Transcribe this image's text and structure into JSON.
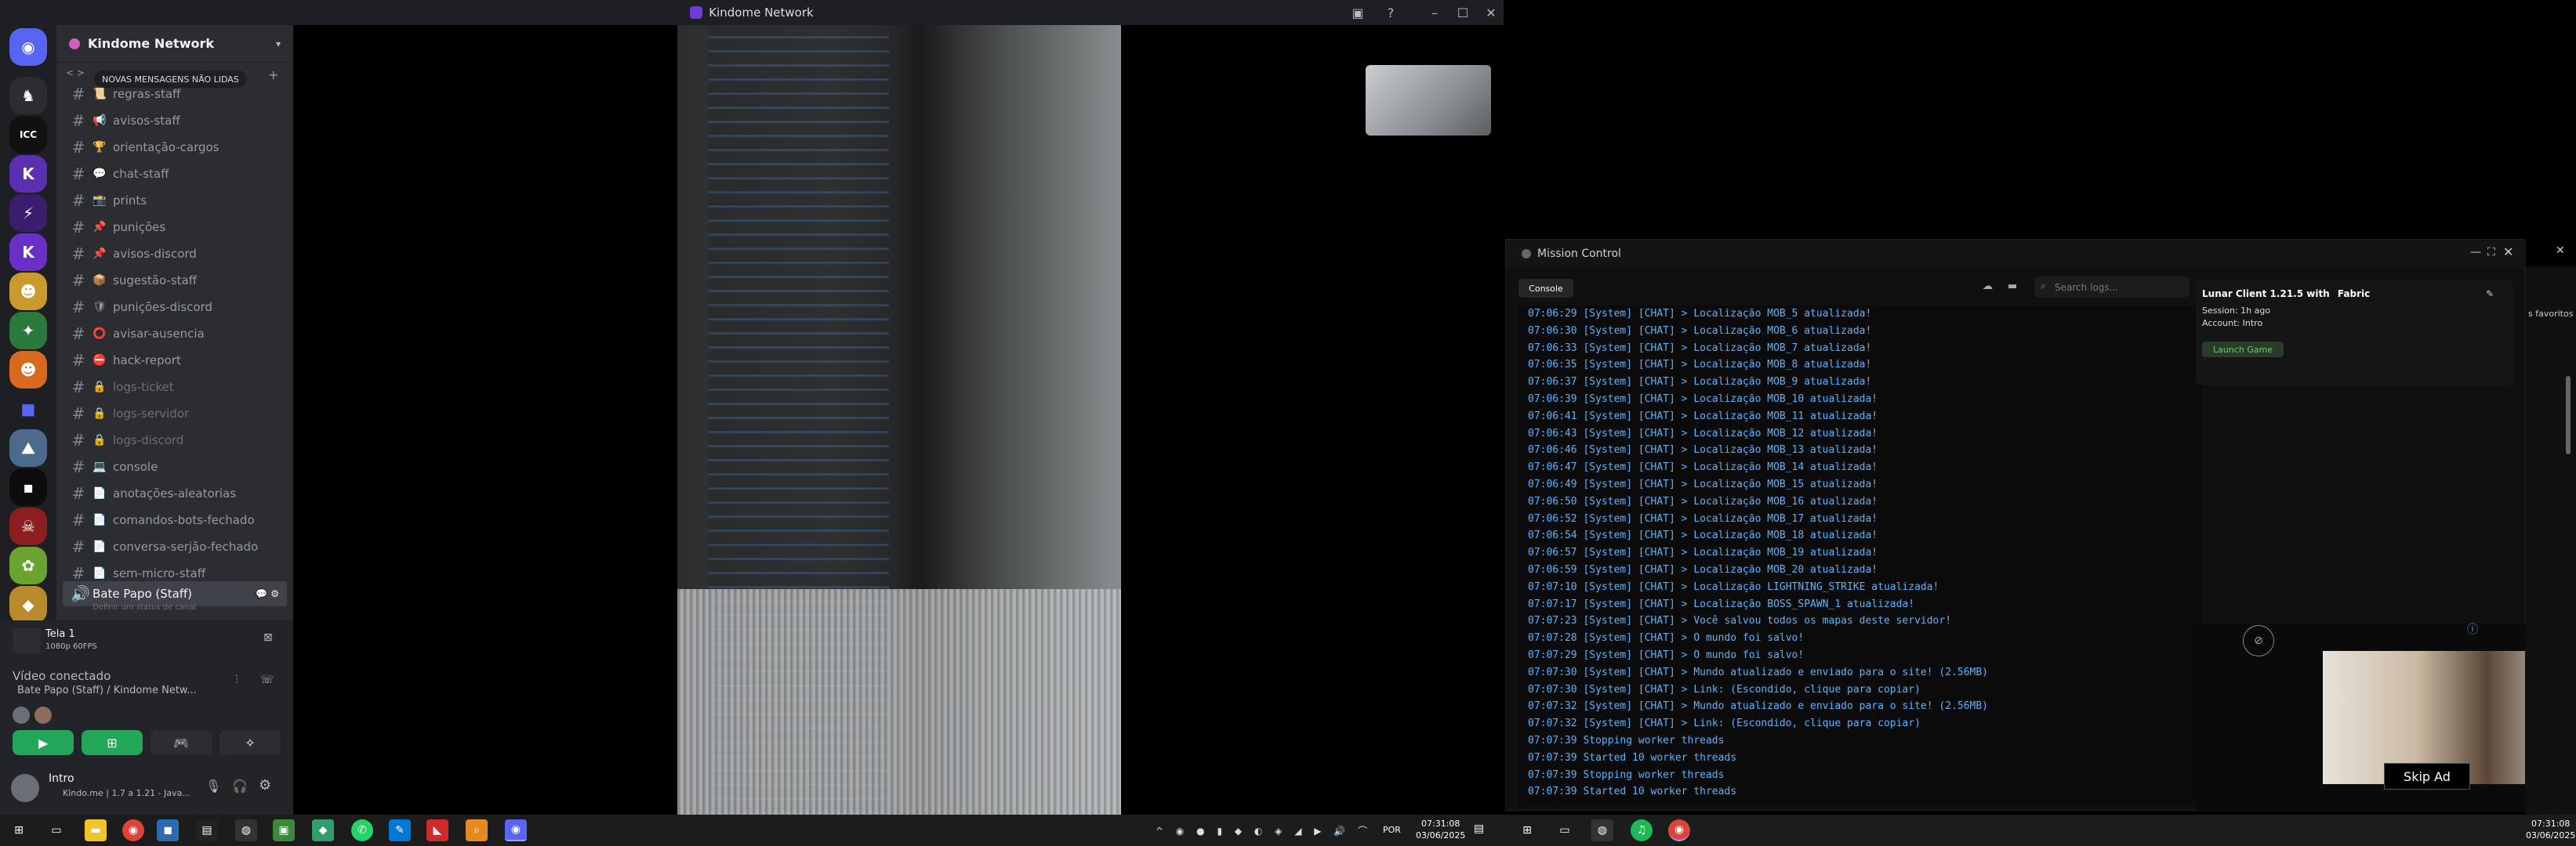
{
  "discord": {
    "window_title": "Kindome Network",
    "server_name": "Kindome Network",
    "new_messages_pill": "NOVAS MENSAGENS NÃO LIDAS",
    "channels": [
      {
        "name": "regras-staff",
        "emoji": "📜",
        "locked": false
      },
      {
        "name": "avisos-staff",
        "emoji": "📢",
        "locked": false
      },
      {
        "name": "orientação-cargos",
        "emoji": "🏆",
        "locked": false
      },
      {
        "name": "chat-staff",
        "emoji": "💬",
        "locked": false
      },
      {
        "name": "prints",
        "emoji": "📸",
        "locked": false
      },
      {
        "name": "punições",
        "emoji": "📌",
        "locked": false
      },
      {
        "name": "avisos-discord",
        "emoji": "📌",
        "locked": false
      },
      {
        "name": "sugestão-staff",
        "emoji": "📦",
        "locked": false
      },
      {
        "name": "punições-discord",
        "emoji": "🛡",
        "locked": false
      },
      {
        "name": "avisar-ausencia",
        "emoji": "⭕",
        "locked": false
      },
      {
        "name": "hack-report",
        "emoji": "⛔",
        "locked": false
      },
      {
        "name": "logs-ticket",
        "emoji": "🔒",
        "locked": true
      },
      {
        "name": "logs-servidor",
        "emoji": "🔒",
        "locked": true
      },
      {
        "name": "logs-discord",
        "emoji": "🔒",
        "locked": true
      },
      {
        "name": "console",
        "emoji": "💻",
        "locked": false
      },
      {
        "name": "anotações-aleatorias",
        "emoji": "📄",
        "locked": false
      },
      {
        "name": "comandos-bots-fechado",
        "emoji": "📄",
        "locked": false
      },
      {
        "name": "conversa-serjão-fechado",
        "emoji": "📄",
        "locked": false
      },
      {
        "name": "sem-micro-staff",
        "emoji": "📄",
        "locked": false
      }
    ],
    "voice_channel": "Bate Papo (Staff)",
    "voice_status_hint": "Definir um status de canal",
    "stream": {
      "title": "Tela 1",
      "quality": "1080p 60FPS"
    },
    "voice_connected": "Vídeo conectado",
    "voice_location": "Bate Papo (Staff) / Kindome Netw...",
    "user": {
      "name": "Intro",
      "status": "Kindo.me | 1.7 a 1.21 - Java..."
    }
  },
  "mission_control": {
    "title": "Mission Control",
    "console_tab": "Console",
    "search_placeholder": "Search logs...",
    "client": "Lunar Client 1.21.5 with",
    "loader": "Fabric",
    "session": "Session: 1h ago",
    "account": "Account: Intro",
    "launch": "Launch Game",
    "skip_ad": "Skip Ad",
    "logs": [
      "07:06:29 [System] [CHAT] > Localização MOB_5 atualizada!",
      "07:06:30 [System] [CHAT] > Localização MOB_6 atualizada!",
      "07:06:33 [System] [CHAT] > Localização MOB_7 atualizada!",
      "07:06:35 [System] [CHAT] > Localização MOB_8 atualizada!",
      "07:06:37 [System] [CHAT] > Localização MOB_9 atualizada!",
      "07:06:39 [System] [CHAT] > Localização MOB_10 atualizada!",
      "07:06:41 [System] [CHAT] > Localização MOB_11 atualizada!",
      "07:06:43 [System] [CHAT] > Localização MOB_12 atualizada!",
      "07:06:46 [System] [CHAT] > Localização MOB_13 atualizada!",
      "07:06:47 [System] [CHAT] > Localização MOB_14 atualizada!",
      "07:06:49 [System] [CHAT] > Localização MOB_15 atualizada!",
      "07:06:50 [System] [CHAT] > Localização MOB_16 atualizada!",
      "07:06:52 [System] [CHAT] > Localização MOB_17 atualizada!",
      "07:06:54 [System] [CHAT] > Localização MOB_18 atualizada!",
      "07:06:57 [System] [CHAT] > Localização MOB_19 atualizada!",
      "07:06:59 [System] [CHAT] > Localização MOB_20 atualizada!",
      "07:07:10 [System] [CHAT] > Localização LIGHTNING_STRIKE atualizada!",
      "07:07:17 [System] [CHAT] > Localização BOSS_SPAWN_1 atualizada!",
      "07:07:23 [System] [CHAT] > Você salvou todos os mapas deste servidor!",
      "07:07:28 [System] [CHAT] > O mundo foi salvo!",
      "07:07:29 [System] [CHAT] > O mundo foi salvo!",
      "07:07:30 [System] [CHAT] > Mundo atualizado e enviado para o site! (2.56MB)",
      "07:07:30 [System] [CHAT] > Link: (Escondido, clique para copiar)",
      "07:07:32 [System] [CHAT] > Mundo atualizado e enviado para o site! (2.56MB)",
      "07:07:32 [System] [CHAT] > Link: (Escondido, clique para copiar)",
      "07:07:39 Stopping worker threads",
      "07:07:39 Started 10 worker threads",
      "07:07:39 Stopping worker threads",
      "07:07:39 Started 10 worker threads"
    ]
  },
  "side_panel": {
    "favorites": "s favoritos"
  },
  "taskbar": {
    "lang": "POR",
    "time1": "07:31:08",
    "date1": "03/06/2025",
    "time2": "07:31:08",
    "date2": "03/06/2025"
  }
}
